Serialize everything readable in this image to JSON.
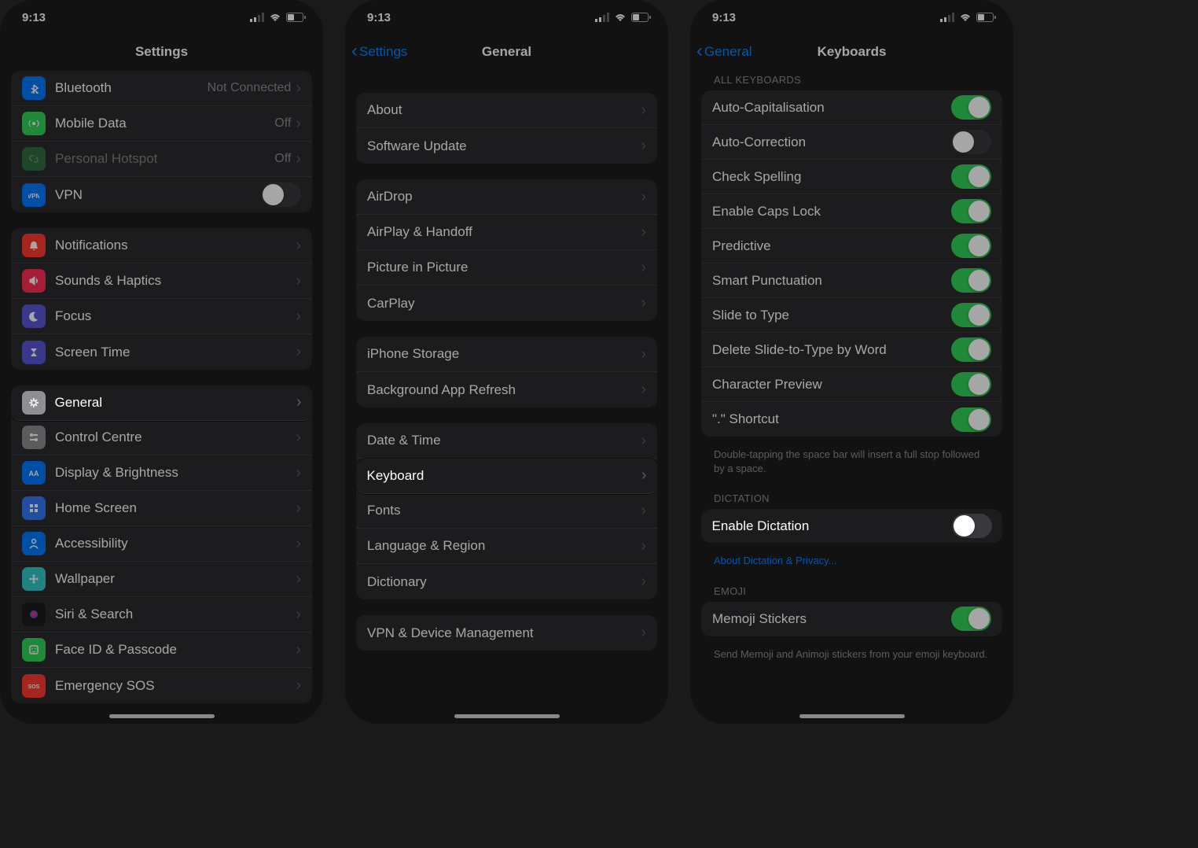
{
  "status": {
    "time": "9:13"
  },
  "phone1": {
    "title": "Settings",
    "rows": [
      {
        "icon": "bt",
        "bg": "#007aff",
        "label": "Bluetooth",
        "detail": "Not Connected",
        "type": "link"
      },
      {
        "icon": "ant",
        "bg": "#30d158",
        "label": "Mobile Data",
        "detail": "Off",
        "type": "link"
      },
      {
        "icon": "link",
        "bg": "#30d158",
        "label": "Personal Hotspot",
        "detail": "Off",
        "type": "link",
        "dim": true
      },
      {
        "icon": "vpn",
        "bg": "#007aff",
        "label": "VPN",
        "type": "toggle",
        "on": false
      }
    ],
    "group2": [
      {
        "icon": "bell",
        "bg": "#ff3b30",
        "label": "Notifications"
      },
      {
        "icon": "speaker",
        "bg": "#ff2d55",
        "label": "Sounds & Haptics"
      },
      {
        "icon": "moon",
        "bg": "#5856d6",
        "label": "Focus"
      },
      {
        "icon": "hourglass",
        "bg": "#5856d6",
        "label": "Screen Time"
      }
    ],
    "group3": [
      {
        "icon": "gear",
        "bg": "#8e8e93",
        "label": "General",
        "highlight": true
      },
      {
        "icon": "switches",
        "bg": "#8e8e93",
        "label": "Control Centre"
      },
      {
        "icon": "AA",
        "bg": "#007aff",
        "label": "Display & Brightness"
      },
      {
        "icon": "grid",
        "bg": "#3478f6",
        "label": "Home Screen"
      },
      {
        "icon": "person",
        "bg": "#007aff",
        "label": "Accessibility"
      },
      {
        "icon": "flower",
        "bg": "#34c8c8",
        "label": "Wallpaper"
      },
      {
        "icon": "siri",
        "bg": "#1c1c1e",
        "label": "Siri & Search"
      },
      {
        "icon": "faceid",
        "bg": "#30d158",
        "label": "Face ID & Passcode"
      },
      {
        "icon": "sos",
        "bg": "#ff3b30",
        "label": "Emergency SOS"
      }
    ]
  },
  "phone2": {
    "back": "Settings",
    "title": "General",
    "g1": [
      {
        "label": "About"
      },
      {
        "label": "Software Update"
      }
    ],
    "g2": [
      {
        "label": "AirDrop"
      },
      {
        "label": "AirPlay & Handoff"
      },
      {
        "label": "Picture in Picture"
      },
      {
        "label": "CarPlay"
      }
    ],
    "g3": [
      {
        "label": "iPhone Storage"
      },
      {
        "label": "Background App Refresh"
      }
    ],
    "g4": [
      {
        "label": "Date & Time"
      },
      {
        "label": "Keyboard",
        "highlight": true
      },
      {
        "label": "Fonts"
      },
      {
        "label": "Language & Region"
      },
      {
        "label": "Dictionary"
      }
    ],
    "g5": [
      {
        "label": "VPN & Device Management"
      }
    ]
  },
  "phone3": {
    "back": "General",
    "title": "Keyboards",
    "allkb_header": "ALL KEYBOARDS",
    "allkb": [
      {
        "label": "Auto-Capitalisation",
        "on": true
      },
      {
        "label": "Auto-Correction",
        "on": false
      },
      {
        "label": "Check Spelling",
        "on": true
      },
      {
        "label": "Enable Caps Lock",
        "on": true
      },
      {
        "label": "Predictive",
        "on": true
      },
      {
        "label": "Smart Punctuation",
        "on": true
      },
      {
        "label": "Slide to Type",
        "on": true
      },
      {
        "label": "Delete Slide-to-Type by Word",
        "on": true
      },
      {
        "label": "Character Preview",
        "on": true
      },
      {
        "label": "\".\" Shortcut",
        "on": true
      }
    ],
    "allkb_footer": "Double-tapping the space bar will insert a full stop followed by a space.",
    "dict_header": "DICTATION",
    "dictation": {
      "label": "Enable Dictation",
      "on": false,
      "highlight": true
    },
    "dict_link": "About Dictation & Privacy...",
    "emoji_header": "EMOJI",
    "emoji": {
      "label": "Memoji Stickers",
      "on": true
    },
    "emoji_footer": "Send Memoji and Animoji stickers from your emoji keyboard."
  }
}
